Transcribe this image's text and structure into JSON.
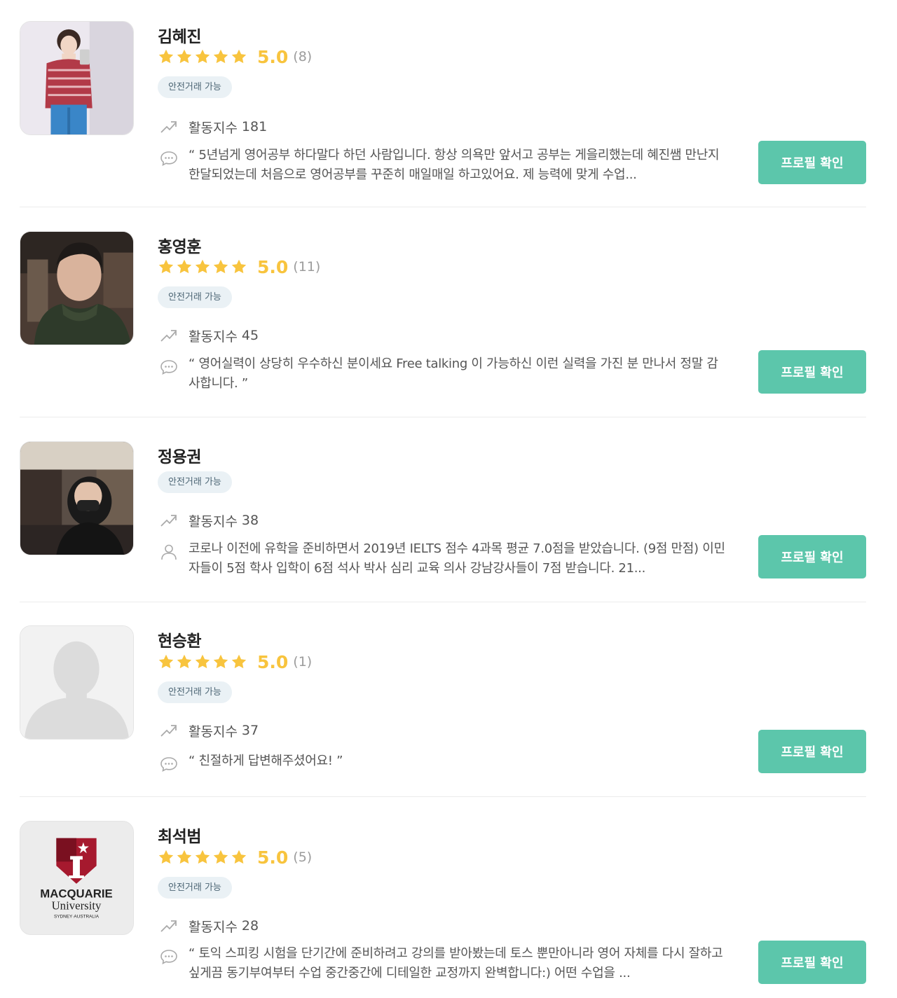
{
  "tutors": [
    {
      "name": "김혜진",
      "rating": "5.0",
      "stars": 5,
      "review_count": "(8)",
      "badge": "안전거래 가능",
      "activity_label": "활동지수",
      "activity_value": "181",
      "review_icon": "chat-bubble-icon",
      "review": "“ 5년넘게 영어공부 하다말다 하던 사람입니다. 항상 의욕만 앞서고 공부는 게을리했는데 혜진쌤 만난지 한달되었는데 처음으로 영어공부를 꾸준히 매일매일 하고있어요. 제 능력에 맞게 수업...",
      "button": "프로필 확인"
    },
    {
      "name": "홍영훈",
      "rating": "5.0",
      "stars": 5,
      "review_count": "(11)",
      "badge": "안전거래 가능",
      "activity_label": "활동지수",
      "activity_value": "45",
      "review_icon": "chat-bubble-icon",
      "review": "“ 영어실력이 상당히 우수하신 분이세요 Free talking 이 가능하신 이런 실력을 가진 분 만나서 정말 감사합니다. ”",
      "button": "프로필 확인"
    },
    {
      "name": "정용권",
      "badge": "안전거래 가능",
      "activity_label": "활동지수",
      "activity_value": "38",
      "review_icon": "person-icon",
      "review": "코로나 이전에 유학을 준비하면서 2019년 IELTS 점수 4과목 평균 7.0점을 받았습니다. (9점 만점) 이민자들이 5점 학사 입학이 6점 석사 박사 심리 교육 의사 강남강사들이 7점 받습니다. 21...",
      "button": "프로필 확인"
    },
    {
      "name": "현승환",
      "rating": "5.0",
      "stars": 5,
      "review_count": "(1)",
      "badge": "안전거래 가능",
      "activity_label": "활동지수",
      "activity_value": "37",
      "review_icon": "chat-bubble-icon",
      "review": "“ 친절하게 답변해주셨어요! ”",
      "button": "프로필 확인"
    },
    {
      "name": "최석범",
      "rating": "5.0",
      "stars": 5,
      "review_count": "(5)",
      "badge": "안전거래 가능",
      "activity_label": "활동지수",
      "activity_value": "28",
      "review_icon": "chat-bubble-icon",
      "review": "“ 토익 스피킹 시험을 단기간에 준비하려고 강의를 받아봤는데 토스 뿐만아니라 영어 자체를 다시 잘하고싶게끔 동기부여부터 수업 중간중간에 디테일한 교정까지 완벽합니다:) 어떤 수업을 ...",
      "button": "프로필 확인",
      "logo": {
        "line1": "MACQUARIE",
        "line2": "University",
        "line3": "SYDNEY·AUSTRALIA"
      }
    }
  ],
  "colors": {
    "star": "#f8c43e",
    "button": "#5cc6ab",
    "badge_bg": "#eaf1f5"
  }
}
